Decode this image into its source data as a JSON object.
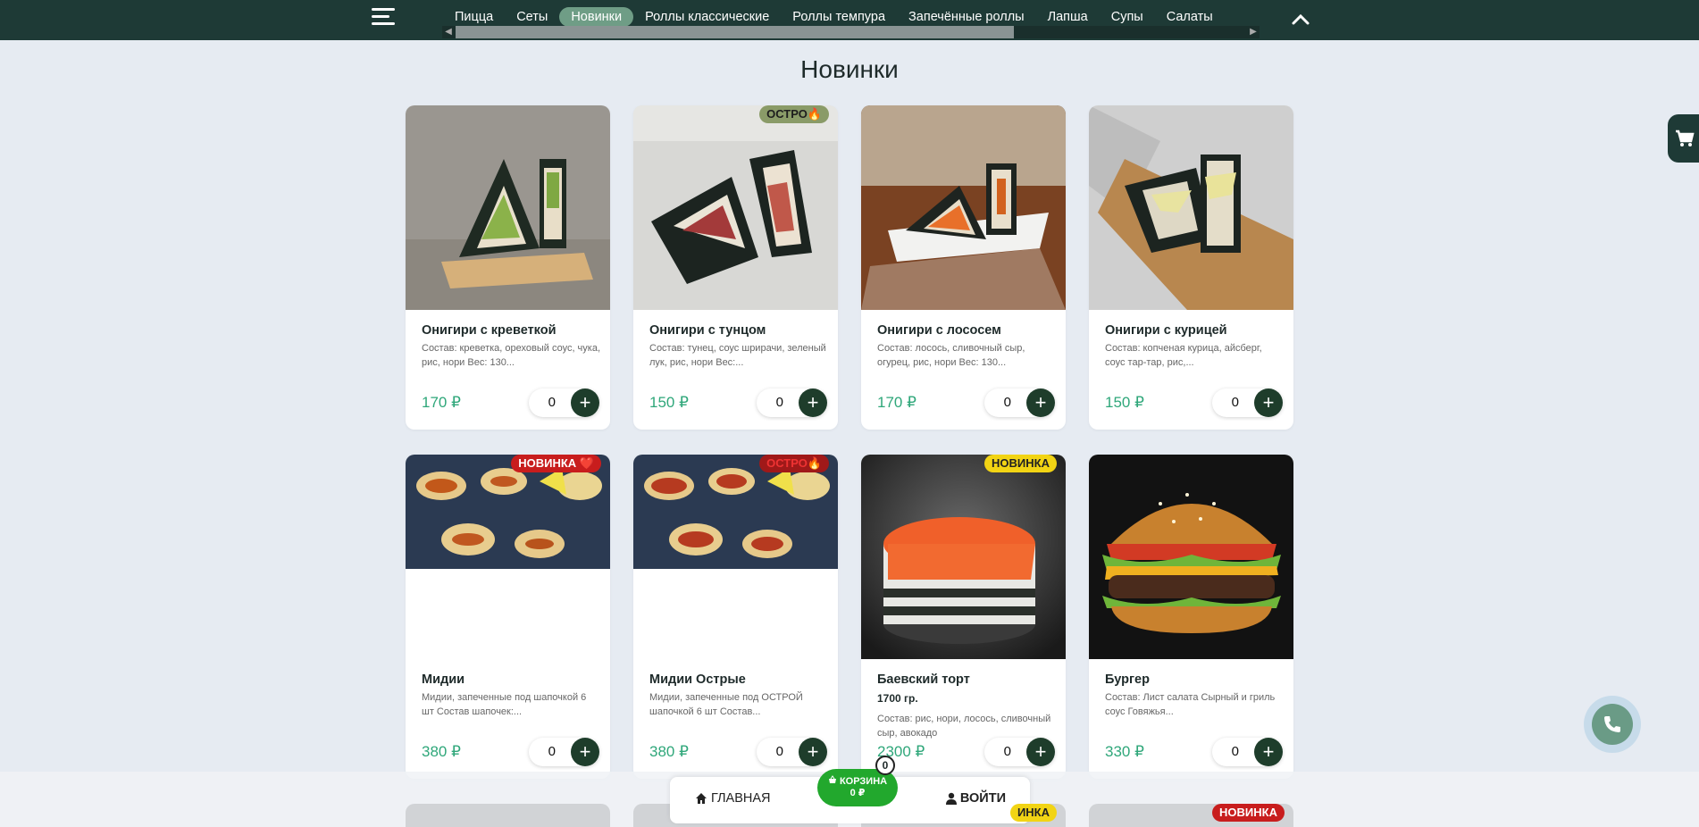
{
  "nav": {
    "items": [
      {
        "label": "Пицца",
        "active": false
      },
      {
        "label": "Сеты",
        "active": false
      },
      {
        "label": "Новинки",
        "active": true
      },
      {
        "label": "Роллы классические",
        "active": false
      },
      {
        "label": "Роллы темпура",
        "active": false
      },
      {
        "label": "Запечённые роллы",
        "active": false
      },
      {
        "label": "Лапша",
        "active": false
      },
      {
        "label": "Супы",
        "active": false
      },
      {
        "label": "Салаты",
        "active": false
      }
    ]
  },
  "page_title": "Новинки",
  "products": [
    {
      "name": "Онигири с креветкой",
      "desc": "Состав: креветка, ореховый соус, чука, рис, нори Вес: 130...",
      "price": "170 ₽",
      "qty": "0",
      "badge": ""
    },
    {
      "name": "Онигири с тунцом",
      "desc": "Состав: тунец, соус шрирачи, зеленый лук, рис, нори Вес:...",
      "price": "150 ₽",
      "qty": "0",
      "badge": "ОСТРО🔥"
    },
    {
      "name": "Онигири с лососем",
      "desc": "Состав: лосось, сливочный сыр, огурец, рис, нори Вес: 130...",
      "price": "170 ₽",
      "qty": "0",
      "badge": ""
    },
    {
      "name": "Онигири с курицей",
      "desc": "Состав: копченая курица, айсберг, соус тар-тар, рис,...",
      "price": "150 ₽",
      "qty": "0",
      "badge": ""
    },
    {
      "name": "Мидии",
      "desc": "Мидии, запеченные под шапочкой 6 шт Состав шапочек:...",
      "price": "380 ₽",
      "qty": "0",
      "badge": "НОВИНКА ❤️"
    },
    {
      "name": "Мидии Острые",
      "desc": "Мидии, запеченные под ОСТРОЙ шапочкой 6 шт Состав...",
      "price": "380 ₽",
      "qty": "0",
      "badge": "ОСТРО🔥"
    },
    {
      "name": "Баевский торт",
      "weight": "1700 гр.",
      "desc": "Состав: рис, нори, лосось, сливочный сыр, авокадо",
      "price": "2300 ₽",
      "qty": "0",
      "badge": "НОВИНКА"
    },
    {
      "name": "Бургер",
      "desc": "Состав: Лист салата Сырный и гриль соус Говяжья...",
      "price": "330 ₽",
      "qty": "0",
      "badge": ""
    }
  ],
  "next_row_badges": [
    "ИНКА",
    "НОВИНКА"
  ],
  "bottom_bar": {
    "home": "ГЛАВНАЯ",
    "cart_label": "КОРЗИНА",
    "cart_total": "0 ₽",
    "cart_count": "0",
    "login": "ВОЙТИ"
  },
  "icons": [
    "menu-icon",
    "chevron-up-icon",
    "home-icon",
    "basket-icon",
    "user-icon",
    "cart-icon",
    "phone-icon"
  ],
  "colors": {
    "header_bg": "#1e3a36",
    "active_tab": "#6f9d86",
    "price": "#2fa77a",
    "add_button": "#1e3d2b",
    "cart_green": "#22a82d"
  }
}
